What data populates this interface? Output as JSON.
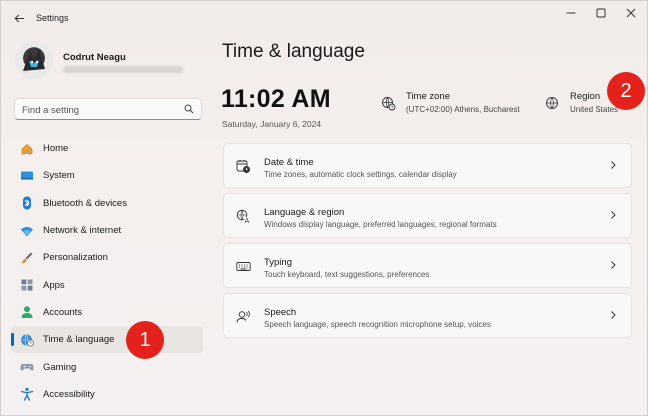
{
  "window": {
    "title": "Settings",
    "controls": [
      "minimize",
      "maximize",
      "close"
    ]
  },
  "user": {
    "name": "Codrut Neagu"
  },
  "search": {
    "placeholder": "Find a setting"
  },
  "sidebar": {
    "items": [
      {
        "label": "Home",
        "icon": "home-icon",
        "active": false
      },
      {
        "label": "System",
        "icon": "system-icon",
        "active": false
      },
      {
        "label": "Bluetooth & devices",
        "icon": "bluetooth-icon",
        "active": false
      },
      {
        "label": "Network & internet",
        "icon": "wifi-icon",
        "active": false
      },
      {
        "label": "Personalization",
        "icon": "brush-icon",
        "active": false
      },
      {
        "label": "Apps",
        "icon": "apps-icon",
        "active": false
      },
      {
        "label": "Accounts",
        "icon": "person-icon",
        "active": false
      },
      {
        "label": "Time & language",
        "icon": "globe-clock-icon",
        "active": true
      },
      {
        "label": "Gaming",
        "icon": "gamepad-icon",
        "active": false
      },
      {
        "label": "Accessibility",
        "icon": "accessibility-icon",
        "active": false
      }
    ]
  },
  "main": {
    "title": "Time & language",
    "clock": {
      "time": "11:02 AM",
      "date": "Saturday, January 6, 2024"
    },
    "timezone": {
      "title": "Time zone",
      "value": "(UTC+02:00) Athens, Bucharest"
    },
    "region": {
      "title": "Region",
      "value": "United States"
    },
    "cards": [
      {
        "title": "Date & time",
        "subtitle": "Time zones, automatic clock settings, calendar display",
        "icon": "calendar-clock-icon"
      },
      {
        "title": "Language & region",
        "subtitle": "Windows display language, preferred languages, regional formats",
        "icon": "language-icon"
      },
      {
        "title": "Typing",
        "subtitle": "Touch keyboard, text suggestions, preferences",
        "icon": "keyboard-icon"
      },
      {
        "title": "Speech",
        "subtitle": "Speech language, speech recognition microphone setup, voices",
        "icon": "speech-icon"
      }
    ]
  },
  "callouts": [
    "1",
    "2"
  ],
  "colors": {
    "accent": "#0067c0",
    "callout": "#e4221b"
  }
}
